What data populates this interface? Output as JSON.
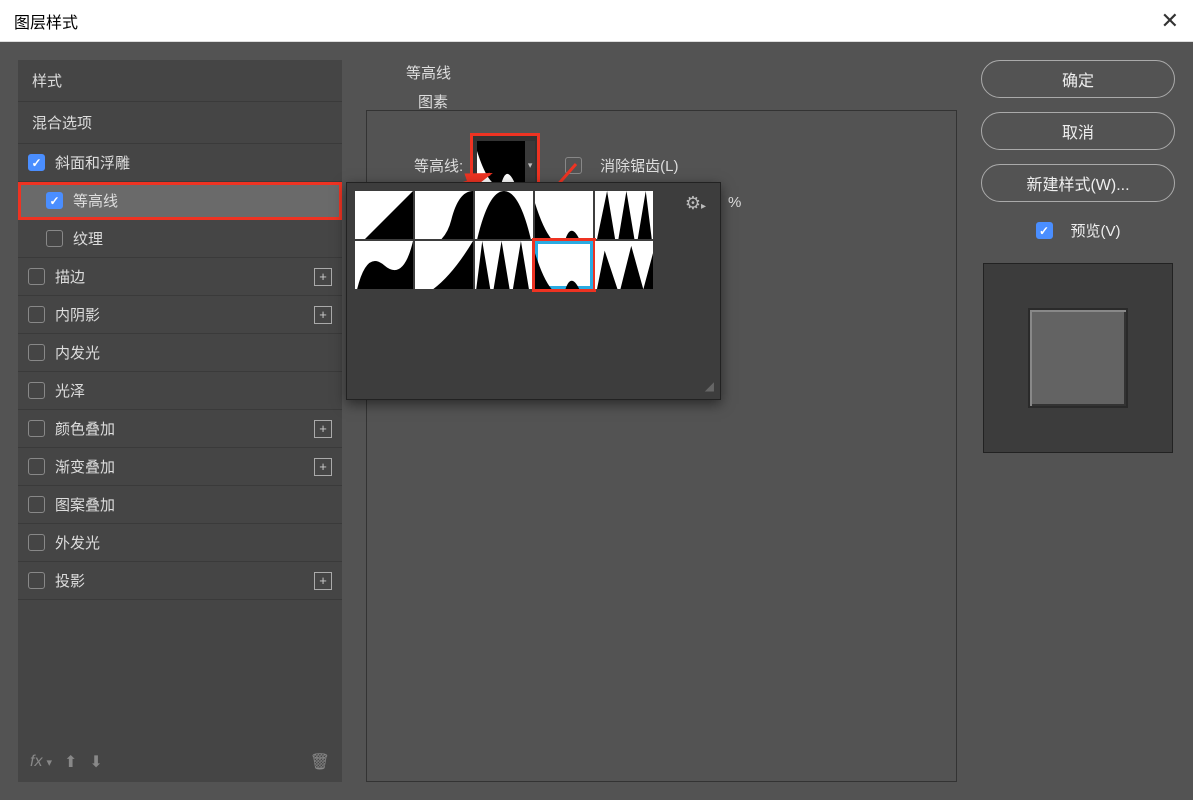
{
  "title": "图层样式",
  "left": {
    "styles_header": "样式",
    "blend_header": "混合选项",
    "items": [
      {
        "label": "斜面和浮雕",
        "checked": true,
        "indent": false,
        "add": false,
        "selected": false,
        "highlighted": false
      },
      {
        "label": "等高线",
        "checked": true,
        "indent": true,
        "add": false,
        "selected": true,
        "highlighted": true
      },
      {
        "label": "纹理",
        "checked": false,
        "indent": true,
        "add": false,
        "selected": false,
        "highlighted": false
      },
      {
        "label": "描边",
        "checked": false,
        "indent": false,
        "add": true,
        "selected": false,
        "highlighted": false
      },
      {
        "label": "内阴影",
        "checked": false,
        "indent": false,
        "add": true,
        "selected": false,
        "highlighted": false
      },
      {
        "label": "内发光",
        "checked": false,
        "indent": false,
        "add": false,
        "selected": false,
        "highlighted": false
      },
      {
        "label": "光泽",
        "checked": false,
        "indent": false,
        "add": false,
        "selected": false,
        "highlighted": false
      },
      {
        "label": "颜色叠加",
        "checked": false,
        "indent": false,
        "add": true,
        "selected": false,
        "highlighted": false
      },
      {
        "label": "渐变叠加",
        "checked": false,
        "indent": false,
        "add": true,
        "selected": false,
        "highlighted": false
      },
      {
        "label": "图案叠加",
        "checked": false,
        "indent": false,
        "add": false,
        "selected": false,
        "highlighted": false
      },
      {
        "label": "外发光",
        "checked": false,
        "indent": false,
        "add": false,
        "selected": false,
        "highlighted": false
      },
      {
        "label": "投影",
        "checked": false,
        "indent": false,
        "add": true,
        "selected": false,
        "highlighted": false
      }
    ],
    "footer_fx": "fx"
  },
  "center": {
    "section": "等高线",
    "subsection": "图素",
    "contour_label": "等高线:",
    "antialiased": "消除锯齿(L)",
    "percent": "%",
    "popup_selected_index": 8
  },
  "right": {
    "ok": "确定",
    "cancel": "取消",
    "new_style": "新建样式(W)...",
    "preview": "预览(V)"
  }
}
